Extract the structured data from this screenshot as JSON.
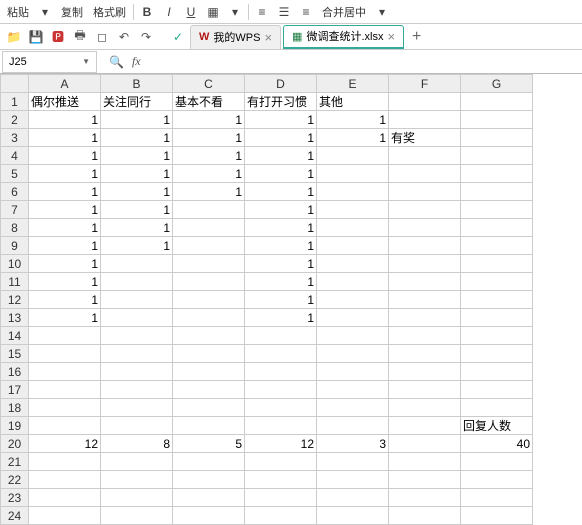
{
  "toolbar": {
    "paste": "粘贴",
    "copy": "复制",
    "format_painter": "格式刷",
    "merge_center": "合并居中"
  },
  "tabs": {
    "my_wps": "我的WPS",
    "active_tab": "微调查统计.xlsx"
  },
  "namebox": "J25",
  "columns": [
    "A",
    "B",
    "C",
    "D",
    "E",
    "F",
    "G"
  ],
  "headers": {
    "A": "偶尔推送",
    "B": "关注同行",
    "C": "基本不看",
    "D": "有打开习惯",
    "E": "其他",
    "F": "",
    "G": ""
  },
  "rows": [
    {
      "n": "1",
      "A": "偶尔推送",
      "B": "关注同行",
      "C": "基本不看",
      "D": "有打开习惯",
      "E": "其他",
      "F": "",
      "G": "",
      "align": "l"
    },
    {
      "n": "2",
      "A": "1",
      "B": "1",
      "C": "1",
      "D": "1",
      "E": "1",
      "F": "",
      "G": ""
    },
    {
      "n": "3",
      "A": "1",
      "B": "1",
      "C": "1",
      "D": "1",
      "E": "1",
      "F": "有奖",
      "G": ""
    },
    {
      "n": "4",
      "A": "1",
      "B": "1",
      "C": "1",
      "D": "1",
      "E": "",
      "F": "",
      "G": ""
    },
    {
      "n": "5",
      "A": "1",
      "B": "1",
      "C": "1",
      "D": "1",
      "E": "",
      "F": "",
      "G": ""
    },
    {
      "n": "6",
      "A": "1",
      "B": "1",
      "C": "1",
      "D": "1",
      "E": "",
      "F": "",
      "G": ""
    },
    {
      "n": "7",
      "A": "1",
      "B": "1",
      "C": "",
      "D": "1",
      "E": "",
      "F": "",
      "G": ""
    },
    {
      "n": "8",
      "A": "1",
      "B": "1",
      "C": "",
      "D": "1",
      "E": "",
      "F": "",
      "G": ""
    },
    {
      "n": "9",
      "A": "1",
      "B": "1",
      "C": "",
      "D": "1",
      "E": "",
      "F": "",
      "G": ""
    },
    {
      "n": "10",
      "A": "1",
      "B": "",
      "C": "",
      "D": "1",
      "E": "",
      "F": "",
      "G": ""
    },
    {
      "n": "11",
      "A": "1",
      "B": "",
      "C": "",
      "D": "1",
      "E": "",
      "F": "",
      "G": ""
    },
    {
      "n": "12",
      "A": "1",
      "B": "",
      "C": "",
      "D": "1",
      "E": "",
      "F": "",
      "G": ""
    },
    {
      "n": "13",
      "A": "1",
      "B": "",
      "C": "",
      "D": "1",
      "E": "",
      "F": "",
      "G": ""
    },
    {
      "n": "14",
      "A": "",
      "B": "",
      "C": "",
      "D": "",
      "E": "",
      "F": "",
      "G": ""
    },
    {
      "n": "15",
      "A": "",
      "B": "",
      "C": "",
      "D": "",
      "E": "",
      "F": "",
      "G": ""
    },
    {
      "n": "16",
      "A": "",
      "B": "",
      "C": "",
      "D": "",
      "E": "",
      "F": "",
      "G": ""
    },
    {
      "n": "17",
      "A": "",
      "B": "",
      "C": "",
      "D": "",
      "E": "",
      "F": "",
      "G": ""
    },
    {
      "n": "18",
      "A": "",
      "B": "",
      "C": "",
      "D": "",
      "E": "",
      "F": "",
      "G": ""
    },
    {
      "n": "19",
      "A": "",
      "B": "",
      "C": "",
      "D": "",
      "E": "",
      "F": "",
      "G": "回复人数"
    },
    {
      "n": "20",
      "A": "12",
      "B": "8",
      "C": "5",
      "D": "12",
      "E": "3",
      "F": "",
      "G": "40"
    },
    {
      "n": "21",
      "A": "",
      "B": "",
      "C": "",
      "D": "",
      "E": "",
      "F": "",
      "G": ""
    },
    {
      "n": "22",
      "A": "",
      "B": "",
      "C": "",
      "D": "",
      "E": "",
      "F": "",
      "G": ""
    },
    {
      "n": "23",
      "A": "",
      "B": "",
      "C": "",
      "D": "",
      "E": "",
      "F": "",
      "G": ""
    },
    {
      "n": "24",
      "A": "",
      "B": "",
      "C": "",
      "D": "",
      "E": "",
      "F": "",
      "G": ""
    }
  ]
}
